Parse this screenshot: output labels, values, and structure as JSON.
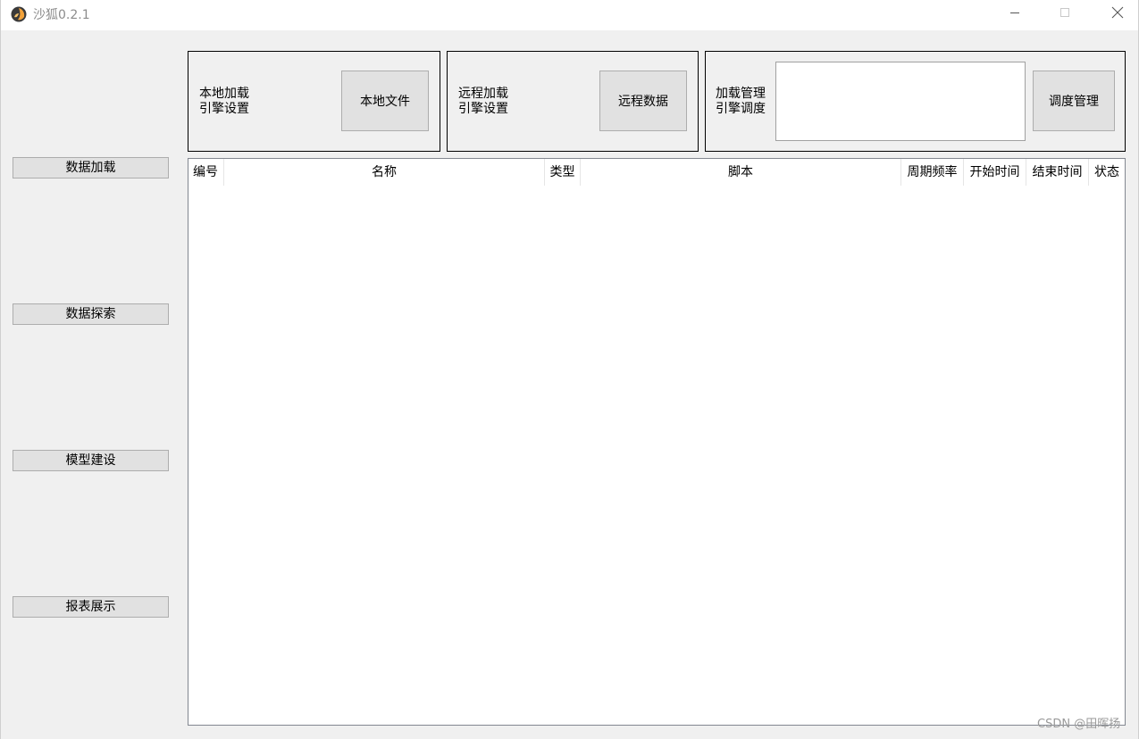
{
  "window": {
    "title": "沙狐0.2.1",
    "icon": "fox-app-icon",
    "controls": [
      "minimize-icon",
      "maximize-icon",
      "close-icon"
    ]
  },
  "sidebar": {
    "items": [
      {
        "label": "数据加载"
      },
      {
        "label": "数据探索"
      },
      {
        "label": "模型建设"
      },
      {
        "label": "报表展示"
      }
    ]
  },
  "panels": {
    "local": {
      "line1": "本地加载",
      "line2": "引擎设置",
      "button": "本地文件"
    },
    "remote": {
      "line1": "远程加载",
      "line2": "引擎设置",
      "button": "远程数据"
    },
    "schedule": {
      "line1": "加载管理",
      "line2": "引擎调度",
      "textarea_value": "",
      "button": "调度管理"
    }
  },
  "table": {
    "columns": [
      "编号",
      "名称",
      "类型",
      "脚本",
      "周期频率",
      "开始时间",
      "结束时间",
      "状态"
    ],
    "rows": []
  },
  "watermark": "CSDN @田晖扬",
  "colors": {
    "window_bg": "#f0f0f0",
    "button_bg": "#e1e1e1",
    "button_border": "#adadad",
    "table_border": "#828790"
  }
}
